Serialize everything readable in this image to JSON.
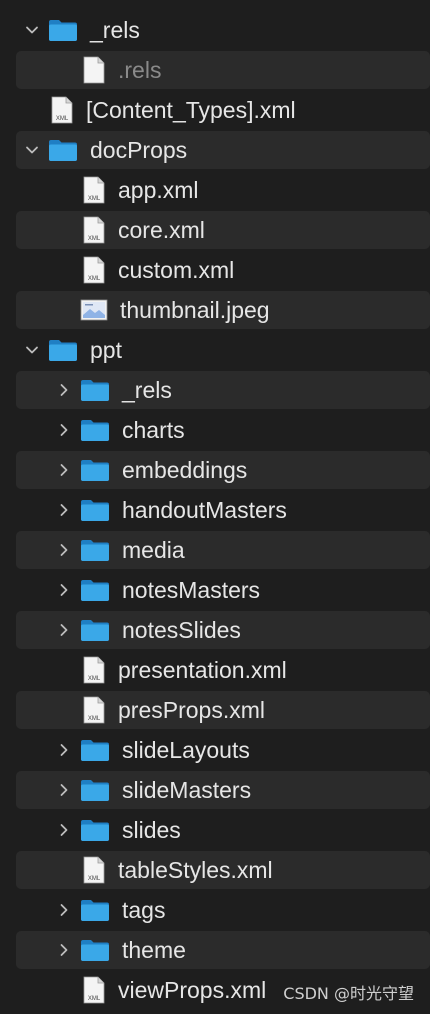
{
  "tree": [
    {
      "label": "_rels",
      "type": "folder",
      "depth": 0,
      "expanded": true
    },
    {
      "label": ".rels",
      "type": "file",
      "depth": 1,
      "dim": true
    },
    {
      "label": "[Content_Types].xml",
      "type": "xml",
      "depth": 0
    },
    {
      "label": "docProps",
      "type": "folder",
      "depth": 0,
      "expanded": true
    },
    {
      "label": "app.xml",
      "type": "xml",
      "depth": 1
    },
    {
      "label": "core.xml",
      "type": "xml",
      "depth": 1
    },
    {
      "label": "custom.xml",
      "type": "xml",
      "depth": 1
    },
    {
      "label": "thumbnail.jpeg",
      "type": "image",
      "depth": 1
    },
    {
      "label": "ppt",
      "type": "folder",
      "depth": 0,
      "expanded": true
    },
    {
      "label": "_rels",
      "type": "folder",
      "depth": 1,
      "expanded": false
    },
    {
      "label": "charts",
      "type": "folder",
      "depth": 1,
      "expanded": false
    },
    {
      "label": "embeddings",
      "type": "folder",
      "depth": 1,
      "expanded": false
    },
    {
      "label": "handoutMasters",
      "type": "folder",
      "depth": 1,
      "expanded": false
    },
    {
      "label": "media",
      "type": "folder",
      "depth": 1,
      "expanded": false
    },
    {
      "label": "notesMasters",
      "type": "folder",
      "depth": 1,
      "expanded": false
    },
    {
      "label": "notesSlides",
      "type": "folder",
      "depth": 1,
      "expanded": false
    },
    {
      "label": "presentation.xml",
      "type": "xml",
      "depth": 1
    },
    {
      "label": "presProps.xml",
      "type": "xml",
      "depth": 1
    },
    {
      "label": "slideLayouts",
      "type": "folder",
      "depth": 1,
      "expanded": false
    },
    {
      "label": "slideMasters",
      "type": "folder",
      "depth": 1,
      "expanded": false
    },
    {
      "label": "slides",
      "type": "folder",
      "depth": 1,
      "expanded": false
    },
    {
      "label": "tableStyles.xml",
      "type": "xml",
      "depth": 1
    },
    {
      "label": "tags",
      "type": "folder",
      "depth": 1,
      "expanded": false
    },
    {
      "label": "theme",
      "type": "folder",
      "depth": 1,
      "expanded": false
    },
    {
      "label": "viewProps.xml",
      "type": "xml",
      "depth": 1
    }
  ],
  "file_badge": "XML",
  "watermark": "CSDN @时光守望",
  "colors": {
    "background": "#1e1e1e",
    "row_alt": "#2b2b2b",
    "folder": "#3aa8e8",
    "text": "#e6e6e6"
  }
}
